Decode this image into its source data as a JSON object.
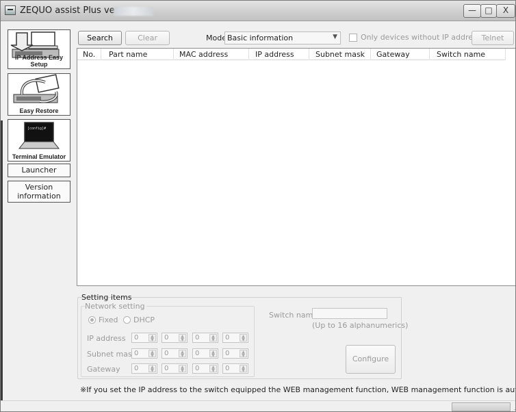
{
  "window": {
    "title": "ZEQUO assist Plus ver.",
    "minimize_glyph": "—",
    "maximize_glyph": "□",
    "close_glyph": "X"
  },
  "nav": {
    "ip_setup": "IP Address Easy Setup",
    "easy_restore": "Easy Restore",
    "terminal": "Terminal Emulator",
    "terminal_screen_text": "[config]#",
    "launcher": "Launcher",
    "version": "Version information"
  },
  "toolbar": {
    "search": "Search",
    "clear": "Clear",
    "mode_label": "Mode",
    "mode_value": "Basic information",
    "only_devices_label": "Only devices without IP address",
    "only_devices_checked": false,
    "telnet": "Telnet"
  },
  "table": {
    "columns": [
      "No.",
      "Part name",
      "MAC address",
      "IP address",
      "Subnet mask",
      "Gateway",
      "Switch name"
    ],
    "rows": []
  },
  "settings": {
    "title": "Setting items",
    "network_title": "Network setting",
    "fixed_label": "Fixed",
    "dhcp_label": "DHCP",
    "selected_mode": "Fixed",
    "ip_address_label": "IP address",
    "subnet_mask_label": "Subnet mask",
    "gateway_label": "Gateway",
    "ip_address": [
      "0",
      "0",
      "0",
      "0"
    ],
    "subnet_mask": [
      "0",
      "0",
      "0",
      "0"
    ],
    "gateway": [
      "0",
      "0",
      "0",
      "0"
    ],
    "switch_name_label": "Switch name",
    "switch_name_value": "",
    "switch_name_hint": "(Up to 16 alphanumerics)",
    "configure": "Configure"
  },
  "footnote": "※If you set the IP address to the switch equipped the WEB management function, WEB management function is automatically enabled."
}
